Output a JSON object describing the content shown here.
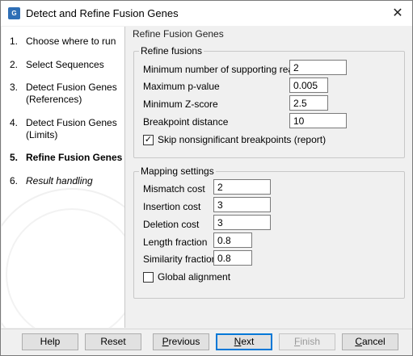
{
  "window": {
    "title": "Detect and Refine Fusion Genes",
    "close_glyph": "✕",
    "app_icon_text": "G"
  },
  "steps": [
    {
      "num": "1.",
      "label": "Choose where to run"
    },
    {
      "num": "2.",
      "label": "Select Sequences"
    },
    {
      "num": "3.",
      "label": "Detect Fusion Genes (References)"
    },
    {
      "num": "4.",
      "label": "Detect Fusion Genes (Limits)"
    },
    {
      "num": "5.",
      "label": "Refine Fusion Genes"
    },
    {
      "num": "6.",
      "label": "Result handling"
    }
  ],
  "main": {
    "title": "Refine Fusion Genes",
    "refine": {
      "legend": "Refine fusions",
      "min_reads_label": "Minimum number of supporting reads",
      "min_reads_value": "2",
      "max_p_label": "Maximum p-value",
      "max_p_value": "0.005",
      "min_z_label": "Minimum Z-score",
      "min_z_value": "2.5",
      "breakpoint_label": "Breakpoint distance",
      "breakpoint_value": "10",
      "skip_label": "Skip nonsignificant breakpoints (report)",
      "skip_checked": true
    },
    "mapping": {
      "legend": "Mapping settings",
      "mismatch_label": "Mismatch cost",
      "mismatch_value": "2",
      "insertion_label": "Insertion cost",
      "insertion_value": "3",
      "deletion_label": "Deletion cost",
      "deletion_value": "3",
      "length_label": "Length fraction",
      "length_value": "0.8",
      "similarity_label": "Similarity fraction",
      "similarity_value": "0.8",
      "global_label": "Global alignment",
      "global_checked": false
    }
  },
  "buttons": {
    "help": "Help",
    "reset": "Reset",
    "previous_pre": "",
    "previous_u": "P",
    "previous_post": "revious",
    "next_pre": "",
    "next_u": "N",
    "next_post": "ext",
    "finish_pre": "",
    "finish_u": "F",
    "finish_post": "inish",
    "cancel_pre": "",
    "cancel_u": "C",
    "cancel_post": "ancel"
  }
}
